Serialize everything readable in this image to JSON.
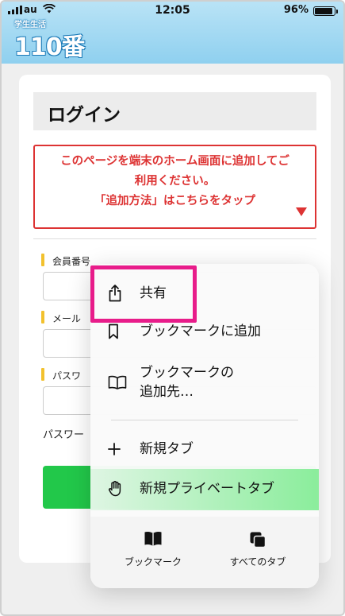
{
  "status": {
    "time": "12:05",
    "carrier": "au",
    "battery": "96%",
    "wifi_icon": "wifi-icon"
  },
  "logo": {
    "small": "学生生活",
    "big": "110番"
  },
  "login": {
    "title": "ログイン",
    "notice_line1": "このページを端末のホーム画面に追加してご",
    "notice_line2": "利用ください。",
    "notice_line3": "「追加方法」はこちらをタップ",
    "member_label": "会員番号",
    "mail_label": "メール",
    "password_label": "パスワ",
    "password_note": "パスワー"
  },
  "menu": {
    "share": "共有",
    "add_bookmark": "ブックマークに追加",
    "bookmark_dest_1": "ブックマークの",
    "bookmark_dest_2": "追加先…",
    "new_tab": "新規タブ",
    "new_private_tab": "新規プライベートタブ",
    "bookmarks": "ブックマーク",
    "all_tabs": "すべてのタブ"
  },
  "colors": {
    "accent_red": "#d33333",
    "highlight": "#e81c8a",
    "login_green": "#22c84a",
    "label_bar": "#f2c12e"
  }
}
